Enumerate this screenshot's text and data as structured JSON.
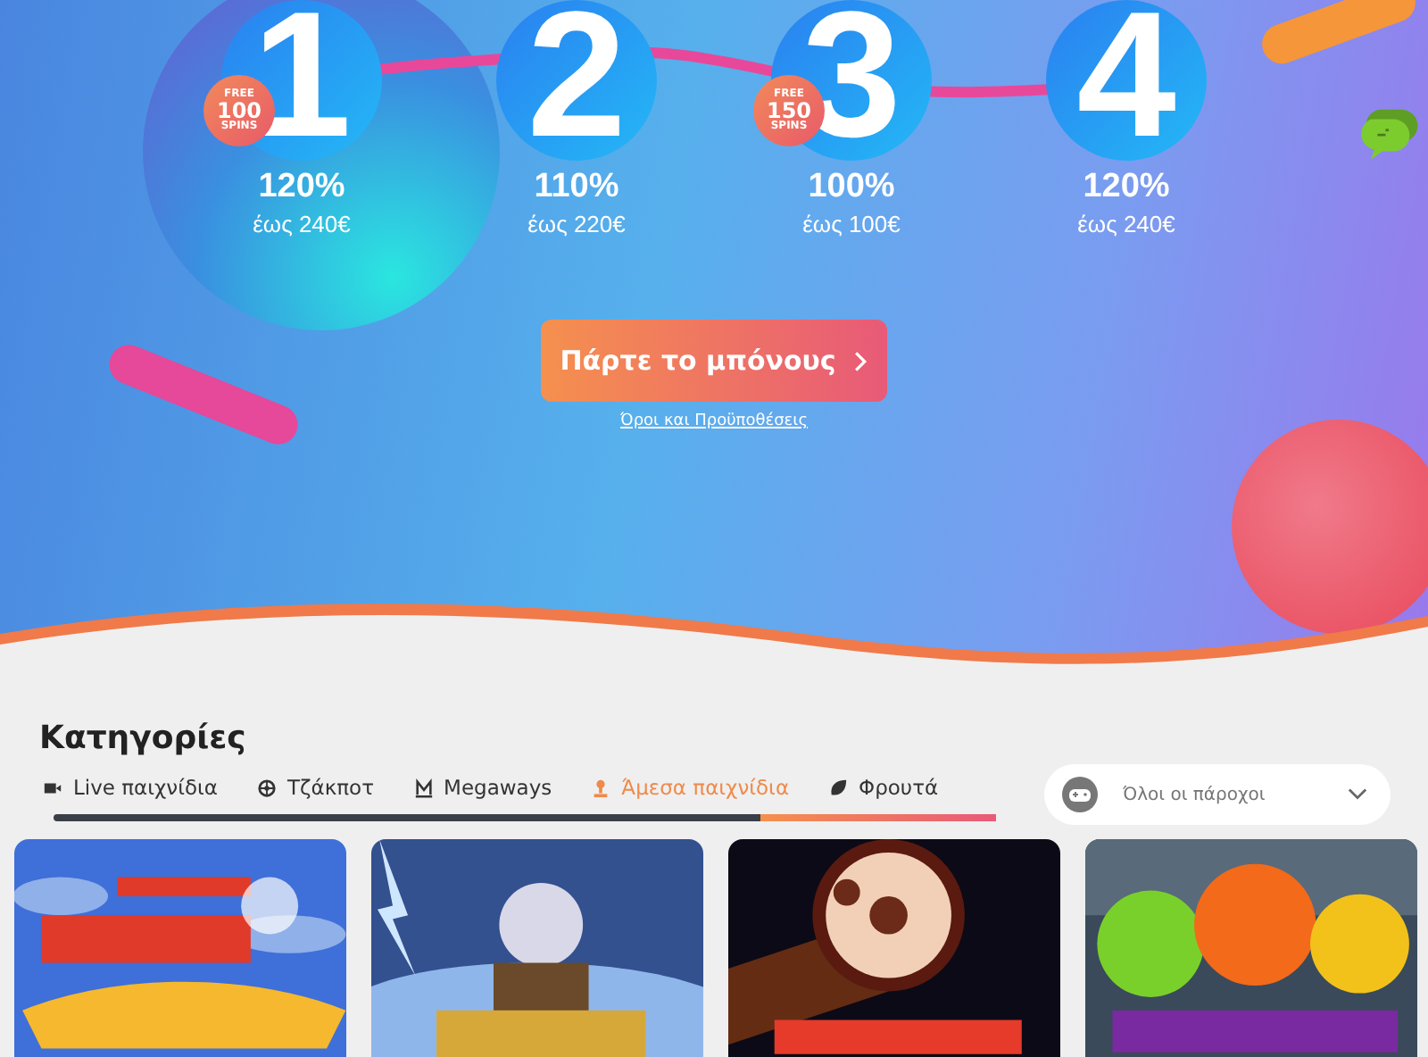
{
  "bonus_steps": [
    {
      "number": "1",
      "percent": "120%",
      "amount": "έως 240€",
      "free_spins": {
        "top": "FREE",
        "count": "100",
        "bottom": "SPINS"
      }
    },
    {
      "number": "2",
      "percent": "110%",
      "amount": "έως 220€"
    },
    {
      "number": "3",
      "percent": "100%",
      "amount": "έως 100€",
      "free_spins": {
        "top": "FREE",
        "count": "150",
        "bottom": "SPINS"
      }
    },
    {
      "number": "4",
      "percent": "120%",
      "amount": "έως 240€"
    }
  ],
  "cta_button": "Πάρτε το μπόνους",
  "terms_link": "Όροι και Προϋποθέσεις",
  "categories": {
    "title": "Κατηγορίες",
    "tabs": [
      {
        "label": "Live παιχνίδια",
        "selected": false
      },
      {
        "label": "Τζάκποτ",
        "selected": false
      },
      {
        "label": "Megaways",
        "selected": false
      },
      {
        "label": "Άμεσα παιχνίδια",
        "selected": true
      },
      {
        "label": "Φρουτά",
        "selected": false
      }
    ],
    "provider_select": {
      "placeholder": "Όλοι οι πάροχοι"
    }
  }
}
